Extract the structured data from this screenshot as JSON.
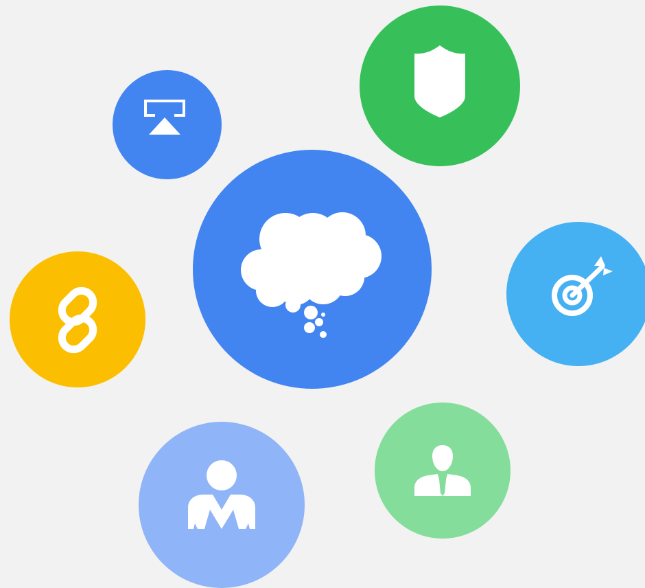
{
  "bubbles": [
    {
      "id": "cloud",
      "icon": "thought-cloud-icon",
      "color": "#4285f0"
    },
    {
      "id": "airplay",
      "icon": "screen-cast-icon",
      "color": "#4285f0"
    },
    {
      "id": "shield",
      "icon": "shield-icon",
      "color": "#37c05a"
    },
    {
      "id": "link",
      "icon": "chain-link-icon",
      "color": "#fbbe00"
    },
    {
      "id": "target",
      "icon": "target-arrow-icon",
      "color": "#45b0f2"
    },
    {
      "id": "user",
      "icon": "user-icon",
      "color": "#8fb4f7"
    },
    {
      "id": "business",
      "icon": "businessman-icon",
      "color": "#84dd9a"
    }
  ]
}
